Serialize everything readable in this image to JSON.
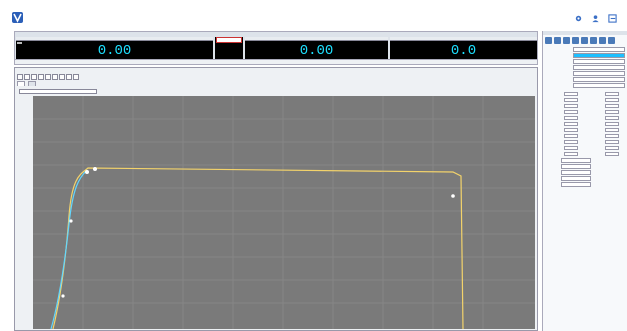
{
  "app": {
    "brand": "",
    "subtitle": "",
    "menu": [
      "",
      "",
      "",
      "",
      ""
    ]
  },
  "topright": {
    "buttons": [
      {
        "label": ""
      },
      {
        "label": ""
      },
      {
        "label": ""
      }
    ]
  },
  "readouts": {
    "title": "",
    "cells": [
      {
        "label": "",
        "value": "0.00"
      },
      {
        "label": "",
        "value": "0.00"
      },
      {
        "label": "",
        "value": "0.0"
      }
    ],
    "spec": {
      "label": "",
      "value": ""
    },
    "status": ""
  },
  "graph": {
    "title": "",
    "tabs": [
      "",
      ""
    ],
    "select": "",
    "header": "",
    "ylabel": "",
    "series": [
      {
        "name": "",
        "color": "#f3d36b"
      },
      {
        "name": "",
        "color": "#61d6ff"
      }
    ]
  },
  "rpanel": {
    "title": "",
    "rows": [
      {
        "label": "",
        "value": ""
      },
      {
        "label": "",
        "value": ""
      },
      {
        "label": "",
        "value": ""
      },
      {
        "label": "",
        "value": ""
      },
      {
        "label": "",
        "value": ""
      },
      {
        "label": "",
        "value": ""
      },
      {
        "label": "",
        "value": ""
      }
    ],
    "section": "",
    "small": [
      {
        "label": ""
      },
      {
        "label": ""
      },
      {
        "label": ""
      },
      {
        "label": ""
      },
      {
        "label": ""
      }
    ]
  },
  "colors": {
    "accent": "#1ebfff",
    "readout_text": "#1ee0ff",
    "plot_bg": "#7a7a7a"
  }
}
